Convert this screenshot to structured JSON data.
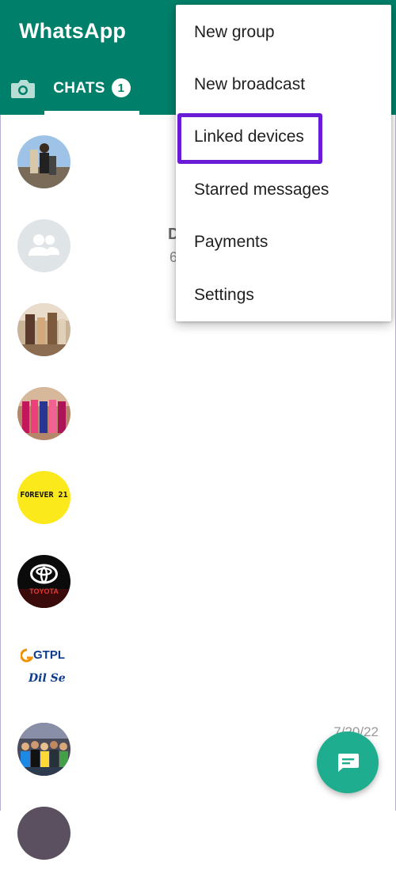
{
  "app": {
    "title": "WhatsApp"
  },
  "tabs": {
    "camera_icon": "camera-icon",
    "chats_label": "CHATS",
    "chats_badge": "1"
  },
  "menu": {
    "items": [
      "New group",
      "New broadcast",
      "Linked devices",
      "Starred messages",
      "Payments",
      "Settings"
    ],
    "highlighted_index": 2,
    "highlight_color": "#6a1bd6"
  },
  "chats": [
    {
      "avatar": "photo-couple"
    },
    {
      "avatar": "group-default-icon",
      "peek_title": "D",
      "peek_sub": "6"
    },
    {
      "avatar": "photo-family"
    },
    {
      "avatar": "photo-group-dresses"
    },
    {
      "avatar": "forever21-logo",
      "avatar_text": "FOREVER 21"
    },
    {
      "avatar": "toyota-logo",
      "avatar_text": "TOYOTA"
    },
    {
      "avatar": "gtpl-logo",
      "avatar_text": "GTPL",
      "avatar_sub": "Dil Se"
    },
    {
      "avatar": "photo-crowd",
      "time": "7/20/22"
    },
    {
      "avatar": "photo-partial"
    }
  ],
  "fab": {
    "icon": "new-chat-icon"
  },
  "colors": {
    "header": "#00806a",
    "fab": "#1eae8f",
    "badge_text": "#00806a"
  }
}
